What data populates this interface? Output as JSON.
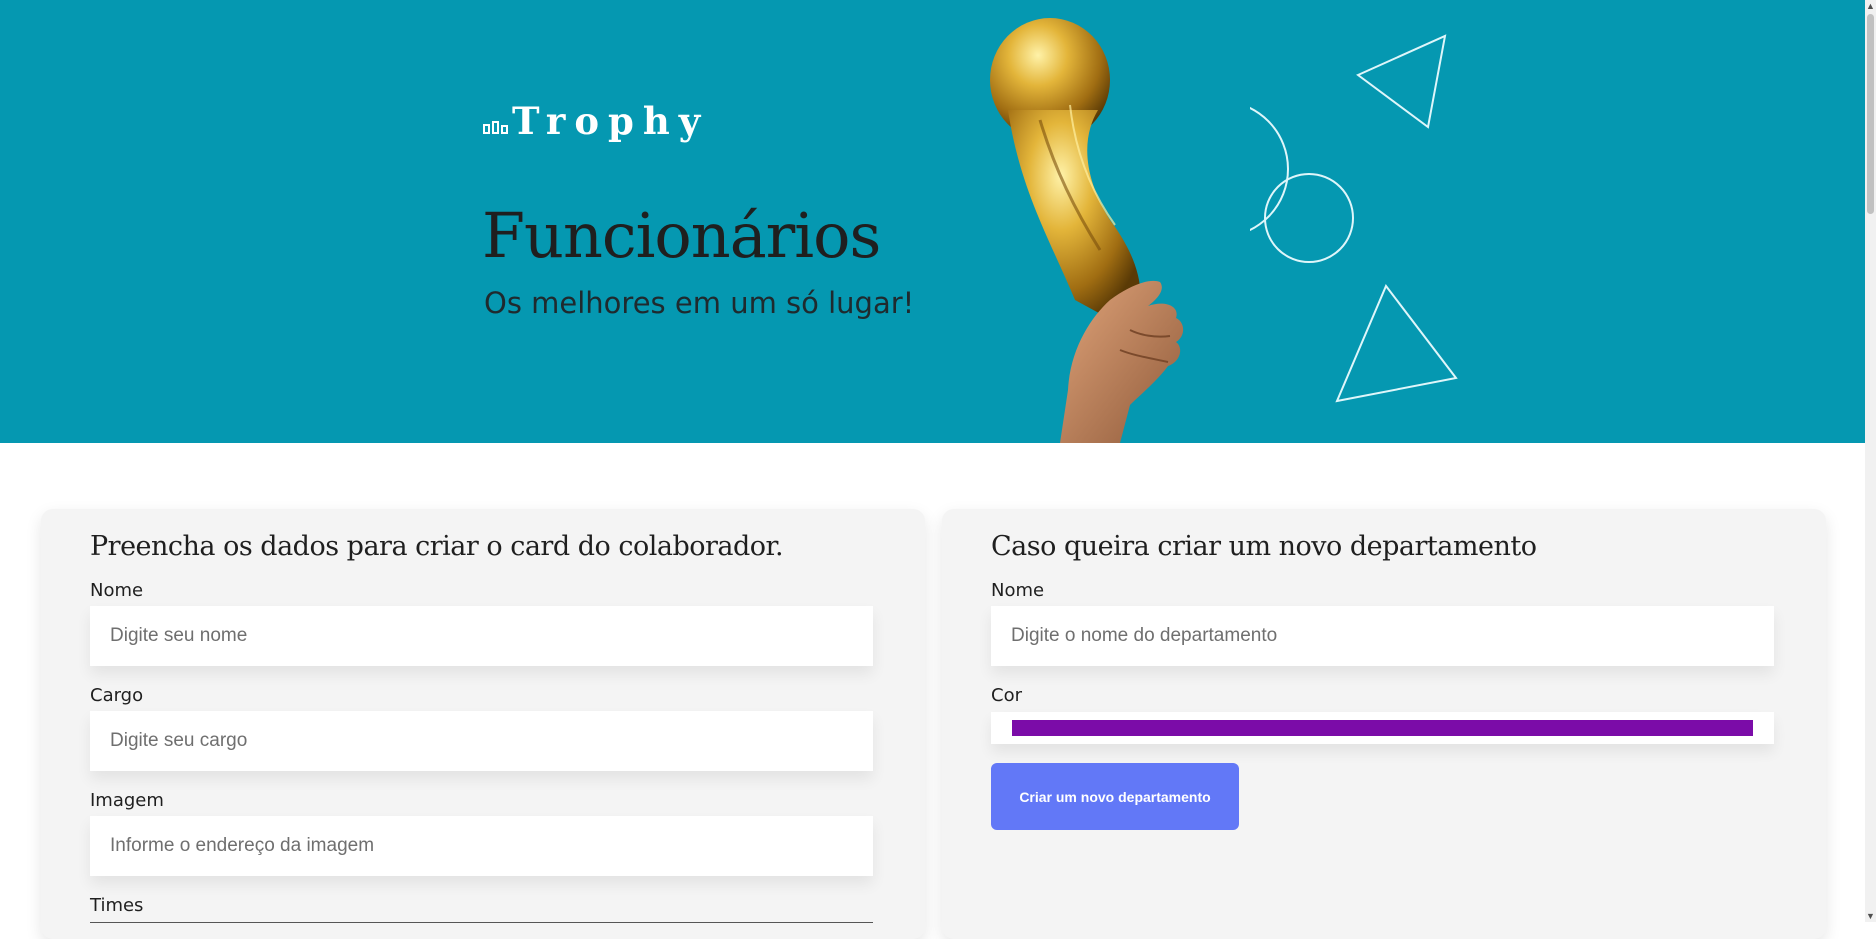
{
  "banner": {
    "logo_text": "Trophy",
    "title": "Funcionários",
    "subtitle": "Os melhores em um só lugar!",
    "background_color": "#0598b1"
  },
  "collaborator_form": {
    "heading": "Preencha os dados para criar o card do colaborador.",
    "fields": [
      {
        "label": "Nome",
        "placeholder": "Digite seu nome"
      },
      {
        "label": "Cargo",
        "placeholder": "Digite seu cargo"
      },
      {
        "label": "Imagem",
        "placeholder": "Informe o endereço da imagem"
      }
    ],
    "teams_label": "Times"
  },
  "department_form": {
    "heading": "Caso queira criar um novo departamento",
    "name_label": "Nome",
    "name_placeholder": "Digite o nome do departamento",
    "color_label": "Cor",
    "color_value": "#7b0ca8",
    "submit_label": "Criar um novo departamento",
    "button_color": "#6278f7"
  },
  "icons": {
    "logo": "bar-chart-icon",
    "scroll_up": "chevron-up-icon",
    "scroll_down": "chevron-down-icon"
  }
}
